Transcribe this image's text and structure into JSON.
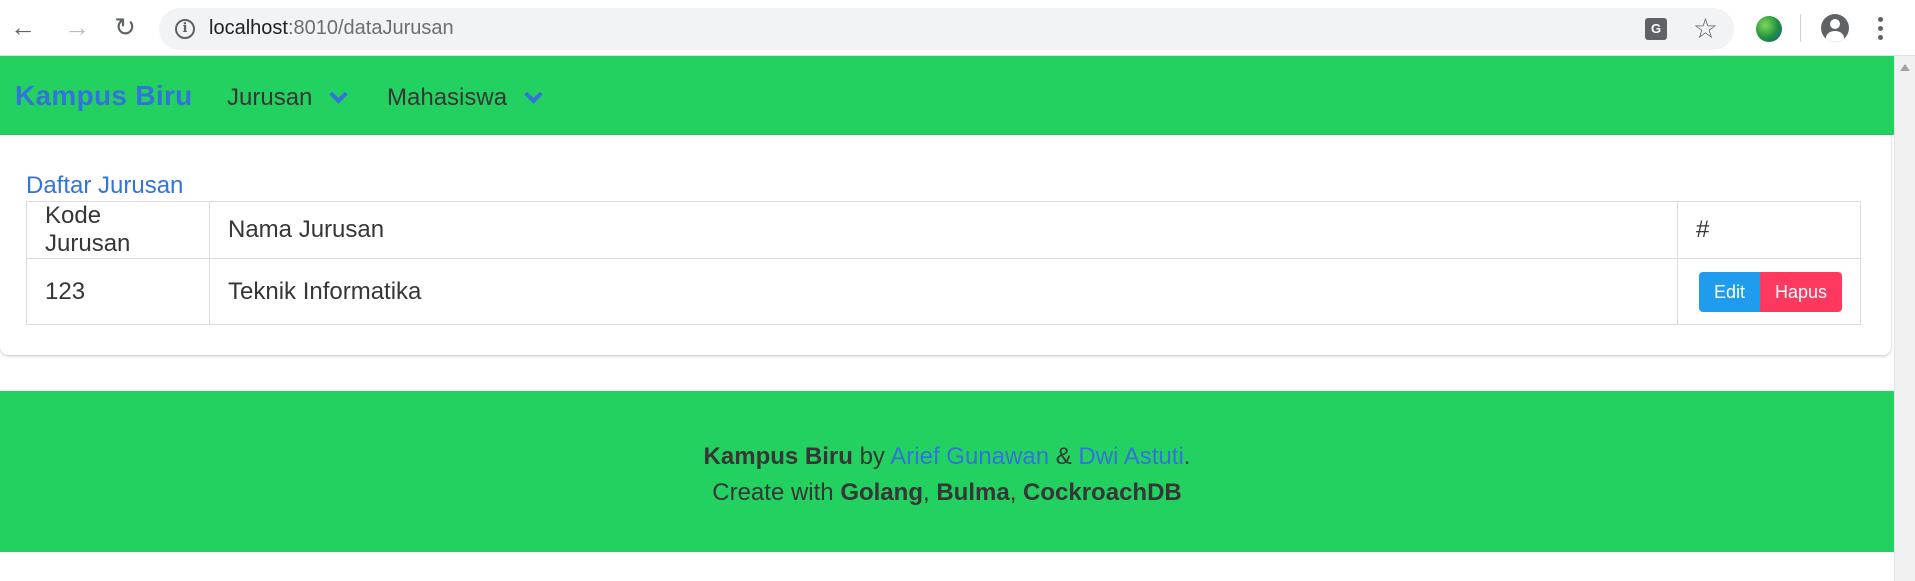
{
  "browser": {
    "url_host": "localhost",
    "url_rest": ":8010/dataJurusan",
    "icons": {
      "back": "back-arrow-icon",
      "forward": "forward-arrow-icon",
      "reload": "reload-icon",
      "info": "info-icon",
      "translate": "translate-icon",
      "bookmark": "star-icon",
      "extension": "extension-icon",
      "account": "account-icon",
      "menu": "kebab-menu-icon"
    }
  },
  "navbar": {
    "brand": "Kampus Biru",
    "items": [
      {
        "label": "Jurusan"
      },
      {
        "label": "Mahasiswa"
      }
    ],
    "colors": {
      "background": "#23d160",
      "brand": "#3273dc"
    }
  },
  "main": {
    "title": "Daftar Jurusan",
    "table": {
      "headers": [
        "Kode Jurusan",
        "Nama Jurusan",
        "#"
      ],
      "rows": [
        {
          "kode": "123",
          "nama": "Teknik Informatika"
        }
      ],
      "actions": {
        "edit": "Edit",
        "hapus": "Hapus"
      }
    },
    "colors": {
      "edit": "#209cee",
      "hapus": "#ff3860"
    }
  },
  "footer": {
    "brand": "Kampus Biru",
    "by": "by",
    "author1": "Arief Gunawan",
    "amp": "&",
    "author2": "Dwi Astuti",
    "period": ".",
    "create_with": "Create with",
    "tech1": "Golang",
    "tech2": "Bulma",
    "tech3": "CockroachDB",
    "comma": ","
  }
}
